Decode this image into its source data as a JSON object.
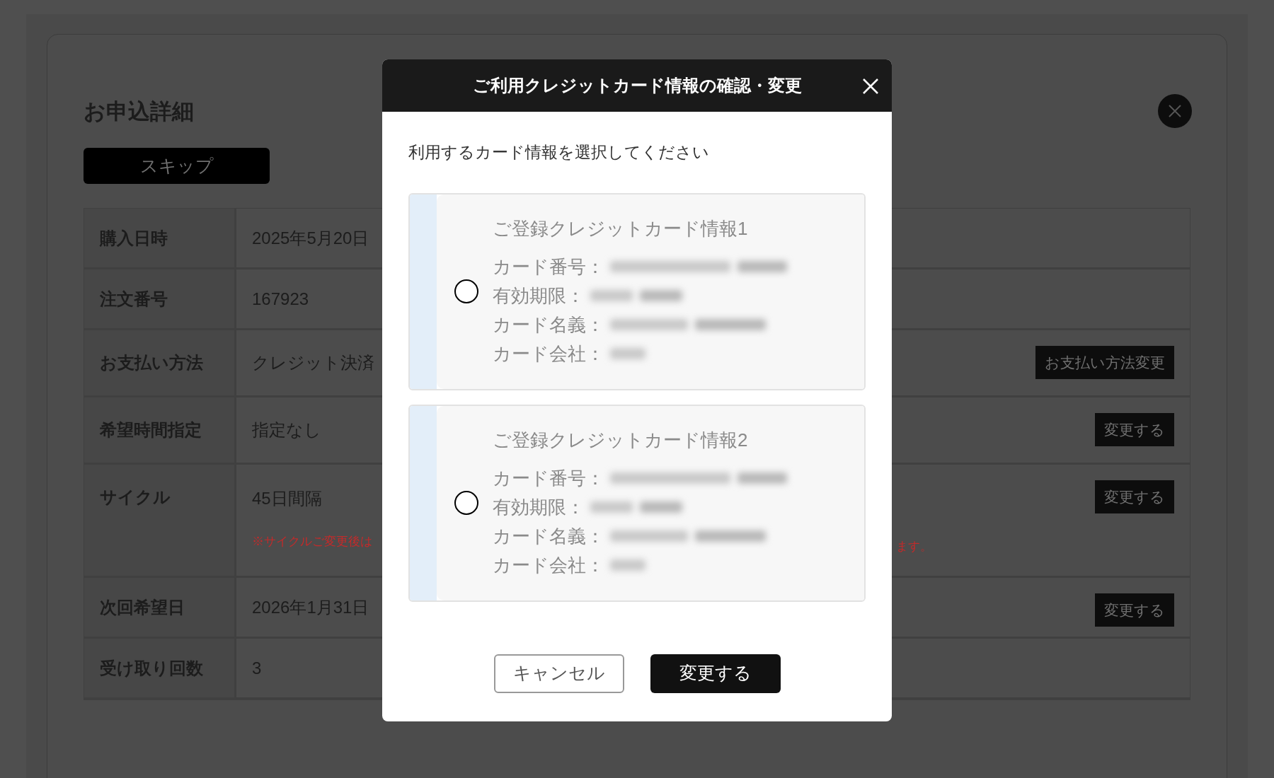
{
  "page": {
    "title": "お申込詳細",
    "skip_button": "スキップ",
    "rows": [
      {
        "label": "購入日時",
        "value": "2025年5月20日"
      },
      {
        "label": "注文番号",
        "value": "167923"
      },
      {
        "label": "お支払い方法",
        "value": "クレジット決済",
        "action": "お支払い方法変更"
      },
      {
        "label": "希望時間指定",
        "value": "指定なし",
        "action": "変更する"
      },
      {
        "label": "サイクル",
        "value": "45日間隔",
        "action": "変更する",
        "note_left": "※サイクルご変更後は",
        "note_right": "ます。"
      },
      {
        "label": "次回希望日",
        "value": "2026年1月31日",
        "action": "変更する"
      },
      {
        "label": "受け取り回数",
        "value": "3"
      }
    ]
  },
  "modal": {
    "title": "ご利用クレジットカード情報の確認・変更",
    "prompt": "利用するカード情報を選択してください",
    "cards": [
      {
        "title": "ご登録クレジットカード情報1",
        "selected": false,
        "fields": [
          "カード番号：",
          "有効期限：",
          "カード名義：",
          "カード会社："
        ]
      },
      {
        "title": "ご登録クレジットカード情報2",
        "selected": false,
        "fields": [
          "カード番号：",
          "有効期限：",
          "カード名義：",
          "カード会社："
        ]
      }
    ],
    "cancel": "キャンセル",
    "confirm": "変更する"
  }
}
